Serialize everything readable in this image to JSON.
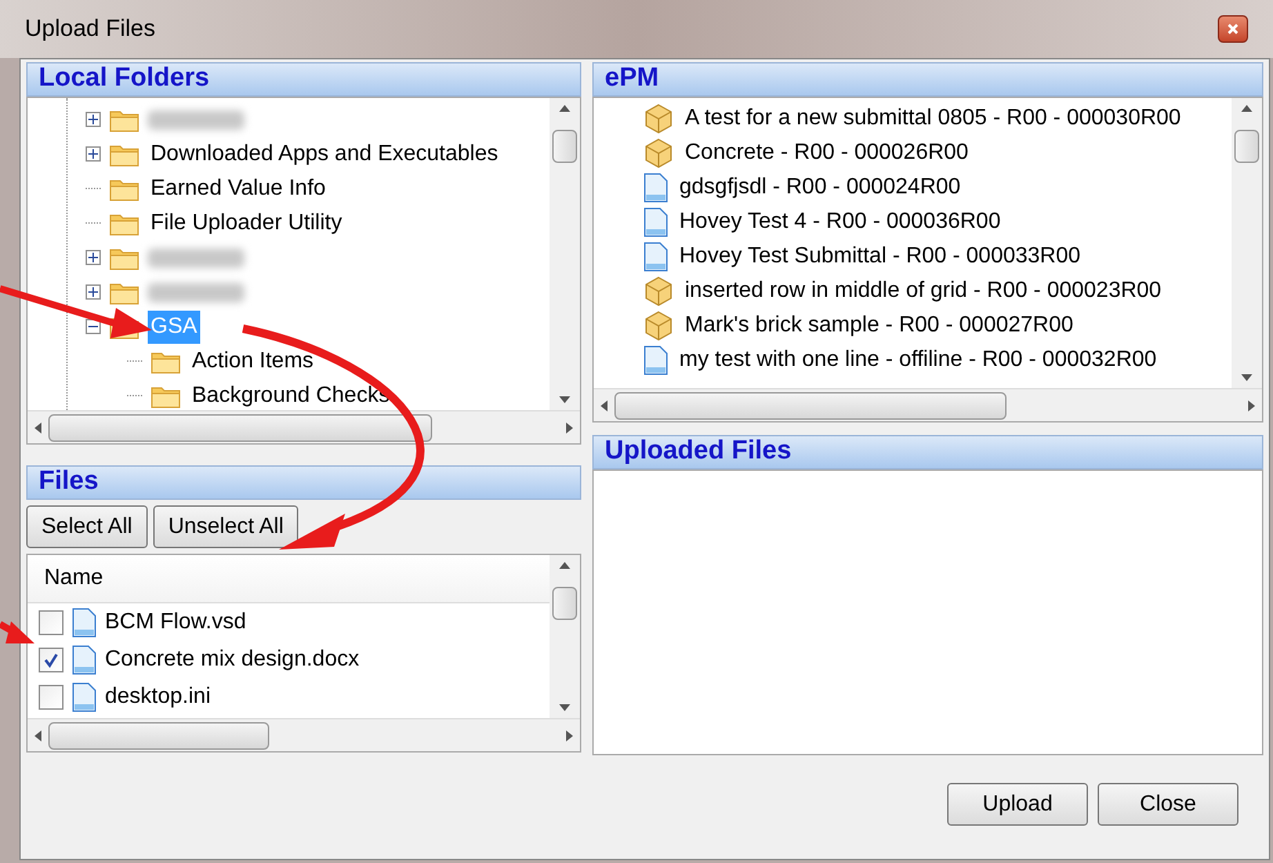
{
  "window": {
    "title": "Upload Files"
  },
  "local_folders": {
    "title": "Local Folders",
    "tree": [
      {
        "kind": "branch",
        "redacted": true,
        "expanded": false
      },
      {
        "kind": "branch",
        "label": "Downloaded Apps and Executables",
        "expanded": false
      },
      {
        "kind": "leaf",
        "label": "Earned Value Info"
      },
      {
        "kind": "leaf",
        "label": "File Uploader Utility"
      },
      {
        "kind": "branch",
        "redacted": true,
        "expanded": false
      },
      {
        "kind": "branch",
        "redacted": true,
        "expanded": false
      },
      {
        "kind": "branch",
        "label": "GSA",
        "expanded": true,
        "selected": true,
        "children": [
          {
            "kind": "leaf",
            "label": "Action Items",
            "selected": false
          },
          {
            "kind": "leaf",
            "label": "Background Checks",
            "selected": false
          }
        ]
      }
    ]
  },
  "files": {
    "title": "Files",
    "buttons": [
      "Select All",
      "Unselect All"
    ],
    "column": "Name",
    "rows": [
      {
        "name": "BCM Flow.vsd",
        "checked": false
      },
      {
        "name": "Concrete mix design.docx",
        "checked": true
      },
      {
        "name": "desktop.ini",
        "checked": false
      }
    ]
  },
  "epm": {
    "title": "ePM",
    "items": [
      {
        "kind": "package",
        "label": "A test for a new submittal 0805 - R00 - 000030R00"
      },
      {
        "kind": "package",
        "label": "Concrete - R00 - 000026R00"
      },
      {
        "kind": "document",
        "label": "gdsgfjsdl - R00 - 000024R00"
      },
      {
        "kind": "document",
        "label": "Hovey Test 4 - R00 - 000036R00"
      },
      {
        "kind": "document",
        "label": "Hovey Test Submittal - R00 - 000033R00"
      },
      {
        "kind": "package",
        "label": "inserted row in middle of grid - R00 - 000023R00"
      },
      {
        "kind": "package",
        "label": "Mark's brick sample - R00 - 000027R00"
      },
      {
        "kind": "document",
        "label": "my test with one line - offiline - R00 - 000032R00"
      }
    ]
  },
  "uploaded": {
    "title": "Uploaded Files"
  },
  "buttons": [
    "Upload",
    "Close"
  ]
}
